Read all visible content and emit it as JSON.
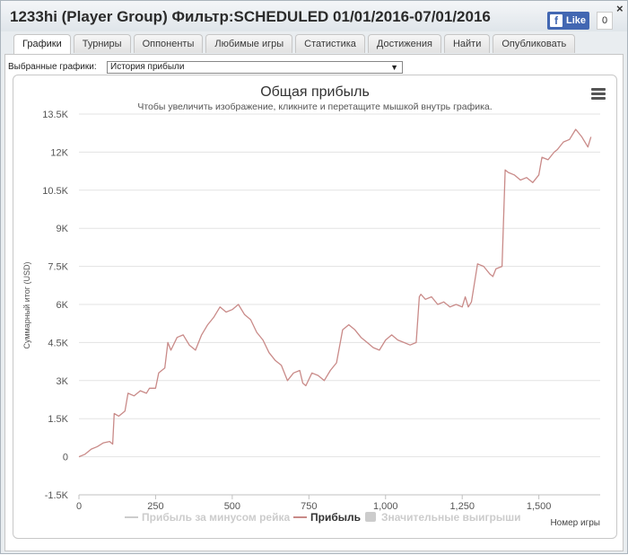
{
  "window": {
    "title": "1233hi (Player Group) Фильтр:SCHEDULED 01/01/2016-07/01/2016",
    "like_label": "Like",
    "like_count": "0",
    "close": "×"
  },
  "tabs": [
    {
      "label": "Графики",
      "active": true
    },
    {
      "label": "Турниры"
    },
    {
      "label": "Оппоненты"
    },
    {
      "label": "Любимые игры"
    },
    {
      "label": "Статистика"
    },
    {
      "label": "Достижения"
    },
    {
      "label": "Найти"
    },
    {
      "label": "Опубликовать"
    }
  ],
  "selector": {
    "label": "Выбранные графики:",
    "value": "История прибыли"
  },
  "chart_data": {
    "type": "line",
    "title": "Общая прибыль",
    "subtitle": "Чтобы увеличить изображение, кликните и перетащите мышкой внутрь графика.",
    "xlabel": "Номер игры",
    "ylabel": "Суммарный итог (USD)",
    "xlim": [
      0,
      1700
    ],
    "ylim": [
      -1500,
      13500
    ],
    "x_ticks": [
      "0",
      "250",
      "500",
      "750",
      "1,000",
      "1,250",
      "1,500"
    ],
    "y_ticks": [
      "13.5K",
      "12K",
      "10.5K",
      "9K",
      "7.5K",
      "6K",
      "4.5K",
      "3K",
      "1.5K",
      "0",
      "-1.5K"
    ],
    "legend": {
      "position": "bottom",
      "items": [
        {
          "name": "Прибыль за минусом рейка",
          "color": "#cccccc",
          "hidden": true
        },
        {
          "name": "Прибыль",
          "color": "#c98a88",
          "hidden": false
        },
        {
          "name": "Значительные выигрыши",
          "color": "#cccccc",
          "hidden": true
        }
      ]
    },
    "series": [
      {
        "name": "Прибыль",
        "color": "#c98a88",
        "x": [
          0,
          20,
          40,
          60,
          80,
          100,
          110,
          115,
          130,
          150,
          160,
          180,
          200,
          220,
          230,
          250,
          260,
          280,
          290,
          300,
          320,
          340,
          360,
          380,
          400,
          420,
          440,
          460,
          480,
          500,
          520,
          540,
          560,
          580,
          600,
          620,
          640,
          660,
          680,
          700,
          720,
          730,
          740,
          760,
          780,
          800,
          820,
          840,
          860,
          880,
          900,
          920,
          940,
          960,
          980,
          1000,
          1010,
          1020,
          1040,
          1060,
          1080,
          1100,
          1110,
          1115,
          1130,
          1150,
          1170,
          1190,
          1210,
          1230,
          1250,
          1260,
          1270,
          1280,
          1300,
          1320,
          1340,
          1350,
          1360,
          1380,
          1390,
          1400,
          1420,
          1440,
          1460,
          1480,
          1500,
          1510,
          1530,
          1550,
          1560,
          1580,
          1600,
          1620,
          1640,
          1660,
          1670
        ],
        "values": [
          0,
          100,
          300,
          400,
          550,
          600,
          500,
          1700,
          1600,
          1800,
          2500,
          2400,
          2600,
          2500,
          2700,
          2700,
          3300,
          3500,
          4500,
          4200,
          4700,
          4800,
          4400,
          4200,
          4800,
          5200,
          5500,
          5900,
          5700,
          5800,
          6000,
          5600,
          5400,
          4900,
          4600,
          4100,
          3800,
          3600,
          3000,
          3300,
          3400,
          2900,
          2800,
          3300,
          3200,
          3000,
          3400,
          3700,
          5000,
          5200,
          5000,
          4700,
          4500,
          4300,
          4200,
          4600,
          4700,
          4800,
          4600,
          4500,
          4400,
          4500,
          6300,
          6400,
          6200,
          6300,
          6000,
          6100,
          5900,
          6000,
          5900,
          6300,
          5900,
          6100,
          7600,
          7500,
          7200,
          7100,
          7400,
          7500,
          11300,
          11200,
          11100,
          10900,
          11000,
          10800,
          11100,
          11800,
          11700,
          12000,
          12100,
          12400,
          12500,
          12900,
          12600,
          12200,
          12600
        ]
      }
    ]
  }
}
